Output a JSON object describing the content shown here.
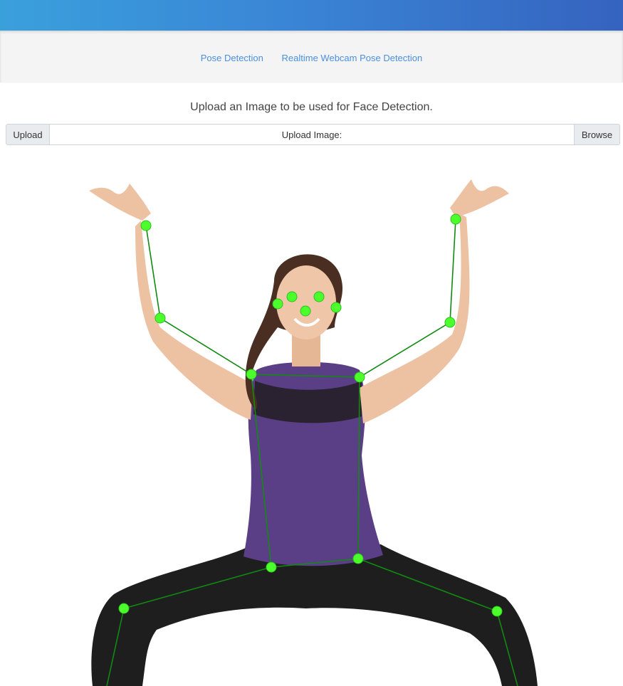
{
  "nav": {
    "pose_detection": "Pose Detection",
    "realtime_webcam": "Realtime Webcam Pose Detection"
  },
  "main": {
    "heading": "Upload an Image to be used for Face Detection.",
    "upload_button": "Upload",
    "upload_field_label": "Upload Image:",
    "browse_button": "Browse"
  },
  "colors": {
    "header_gradient_start": "#3aa0dc",
    "header_gradient_end": "#3563bf",
    "link": "#4a8fe0",
    "keypoint": "#4cff2c",
    "skeleton_line": "#118a11",
    "top_color": "#5b3f86",
    "legging_color": "#1e1e1e",
    "skin": "#ecc2a3"
  },
  "image": {
    "icon": "woman-yoga-pose-photo"
  }
}
